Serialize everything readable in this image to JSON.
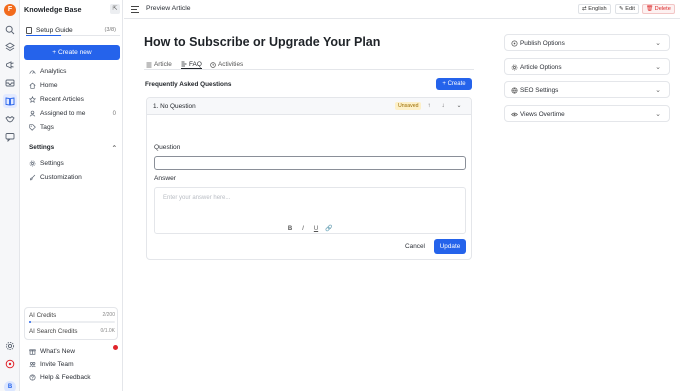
{
  "app": {
    "name": "Knowledge Base",
    "logo_letter": "F",
    "avatar_letter": "B"
  },
  "rail": {
    "icons": [
      "search-icon",
      "layers-icon",
      "megaphone-icon",
      "inbox-icon",
      "book-icon",
      "handshake-icon",
      "chat-icon",
      "settings-icon",
      "alert-icon"
    ]
  },
  "sidebar": {
    "guide": {
      "label": "Setup Guide",
      "count": "(3/8)",
      "progress": 0.375
    },
    "create_label": "+ Create new",
    "items": [
      {
        "label": "Analytics",
        "icon": "analytics-icon"
      },
      {
        "label": "Home",
        "icon": "home-icon"
      },
      {
        "label": "Recent Articles",
        "icon": "star-icon"
      },
      {
        "label": "Assigned to me",
        "icon": "user-icon",
        "count": "0"
      },
      {
        "label": "Tags",
        "icon": "tag-icon"
      }
    ],
    "settings_section": {
      "title": "Settings",
      "items": [
        {
          "label": "Settings",
          "icon": "gear-icon"
        },
        {
          "label": "Customization",
          "icon": "brush-icon"
        }
      ]
    },
    "credits": {
      "ai": {
        "label": "AI Credits",
        "value": "2/200",
        "fraction": 0.01
      },
      "ai_search": {
        "label": "AI Search Credits",
        "value": "0/1.0K",
        "fraction": 0.0
      }
    },
    "footer": [
      {
        "label": "What's New",
        "icon": "gift-icon"
      },
      {
        "label": "Invite Team",
        "icon": "team-icon"
      },
      {
        "label": "Help & Feedback",
        "icon": "help-icon"
      }
    ]
  },
  "topbar": {
    "breadcrumb": "Preview Article",
    "language": "English",
    "edit": "Edit",
    "delete": "Delete"
  },
  "article": {
    "title": "How to Subscribe or Upgrade Your Plan",
    "tabs": [
      {
        "label": "Article",
        "icon": "list-icon"
      },
      {
        "label": "FAQ",
        "icon": "faq-icon"
      },
      {
        "label": "Activities",
        "icon": "activity-icon"
      }
    ],
    "active_tab": "FAQ"
  },
  "faq": {
    "title": "Frequently Asked Questions",
    "create_label": "+ Create",
    "item": {
      "heading": "1. No Question",
      "badge": "Unsaved",
      "question_label": "Question",
      "question_value": "",
      "answer_label": "Answer",
      "answer_placeholder": "Enter your answer here...",
      "format_buttons": [
        "B",
        "I",
        "U",
        "🔗"
      ],
      "cancel": "Cancel",
      "update": "Update"
    }
  },
  "right_panel": [
    {
      "label": "Publish Options",
      "icon": "publish-icon"
    },
    {
      "label": "Article Options",
      "icon": "gear-icon"
    },
    {
      "label": "SEO Settings",
      "icon": "seo-icon"
    },
    {
      "label": "Views Overtime",
      "icon": "eye-icon"
    }
  ],
  "colors": {
    "primary": "#2563eb",
    "brand": "#f26b1d",
    "danger": "#dc2626",
    "warning_bg": "#fdf0c8",
    "notification": "#e0242b"
  }
}
